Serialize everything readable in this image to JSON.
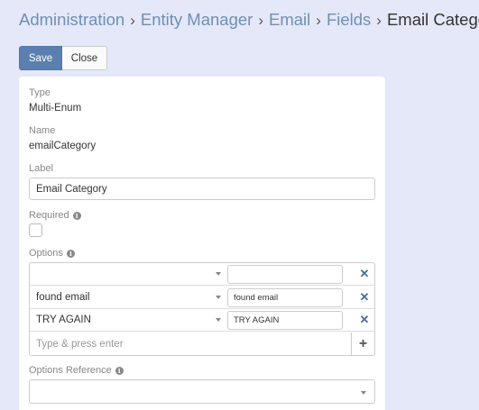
{
  "breadcrumb": {
    "items": [
      "Administration",
      "Entity Manager",
      "Email",
      "Fields"
    ],
    "current": "Email Category",
    "separator": "›"
  },
  "toolbar": {
    "save_label": "Save",
    "close_label": "Close"
  },
  "form": {
    "type": {
      "label": "Type",
      "value": "Multi-Enum"
    },
    "name": {
      "label": "Name",
      "value": "emailCategory"
    },
    "label_field": {
      "label": "Label",
      "value": "Email Category"
    },
    "required": {
      "label": "Required",
      "checked": false
    },
    "options": {
      "label": "Options",
      "rows": [
        {
          "value": "",
          "translation": ""
        },
        {
          "value": "found email",
          "translation": "found email"
        },
        {
          "value": "TRY AGAIN",
          "translation": "TRY AGAIN"
        }
      ],
      "add_placeholder": "Type & press enter"
    },
    "options_reference": {
      "label": "Options Reference",
      "value": ""
    }
  },
  "icons": {
    "info": "info-icon",
    "remove": "close-icon",
    "add": "plus-icon",
    "dropdown": "caret-down-icon"
  },
  "colors": {
    "background": "#e4e8f8",
    "primary_button": "#5b80b0",
    "breadcrumb_link": "#6f8fb5",
    "remove_icon": "#4a6f9c"
  }
}
